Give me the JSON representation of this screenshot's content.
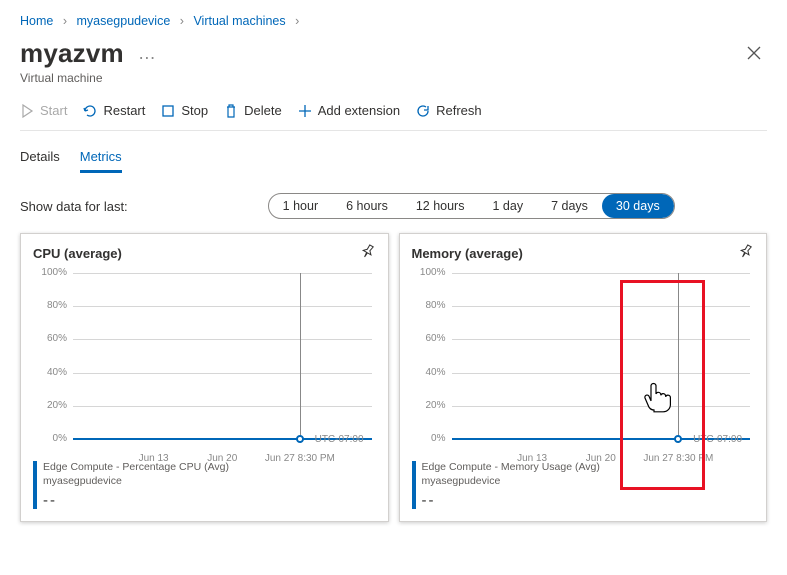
{
  "breadcrumb": {
    "home": "Home",
    "device": "myasegpudevice",
    "vms": "Virtual machines"
  },
  "header": {
    "title": "myazvm",
    "subtitle": "Virtual machine",
    "more": "…"
  },
  "toolbar": {
    "start": "Start",
    "restart": "Restart",
    "stop": "Stop",
    "delete": "Delete",
    "add_ext": "Add extension",
    "refresh": "Refresh"
  },
  "tabs": {
    "details": "Details",
    "metrics": "Metrics"
  },
  "show_label": "Show data for last:",
  "ranges": [
    "1 hour",
    "6 hours",
    "12 hours",
    "1 day",
    "7 days",
    "30 days"
  ],
  "active_range": "30 days",
  "cards": {
    "cpu": {
      "title": "CPU (average)",
      "legend_name": "Edge Compute - Percentage CPU (Avg)",
      "legend_sub": "myasegpudevice",
      "value": "--"
    },
    "mem": {
      "title": "Memory (average)",
      "legend_name": "Edge Compute - Memory Usage (Avg)",
      "legend_sub": "myasegpudevice",
      "value": "--"
    }
  },
  "chart_data": [
    {
      "type": "line",
      "title": "CPU (average)",
      "ylabel": "",
      "ylim": [
        0,
        100
      ],
      "yticks": [
        "0%",
        "20%",
        "40%",
        "60%",
        "80%",
        "100%"
      ],
      "x_ticks": [
        {
          "label": "Jun 13",
          "pos": 27
        },
        {
          "label": "Jun 20",
          "pos": 50
        },
        {
          "label": "Jun 27 8:30 PM",
          "pos": 76
        }
      ],
      "timezone": "UTC-07:00",
      "series": [
        {
          "name": "Edge Compute - Percentage CPU (Avg)",
          "color": "#0067b8",
          "constant_value_pct": 0
        }
      ],
      "hover": {
        "x_pct": 76
      }
    },
    {
      "type": "line",
      "title": "Memory (average)",
      "ylabel": "",
      "ylim": [
        0,
        100
      ],
      "yticks": [
        "0%",
        "20%",
        "40%",
        "60%",
        "80%",
        "100%"
      ],
      "x_ticks": [
        {
          "label": "Jun 13",
          "pos": 27
        },
        {
          "label": "Jun 20",
          "pos": 50
        },
        {
          "label": "Jun 27 8:30 PM",
          "pos": 76
        }
      ],
      "timezone": "UTC-07:00",
      "series": [
        {
          "name": "Edge Compute - Memory Usage (Avg)",
          "color": "#0067b8",
          "constant_value_pct": 0
        }
      ],
      "hover": {
        "x_pct": 76
      }
    }
  ]
}
